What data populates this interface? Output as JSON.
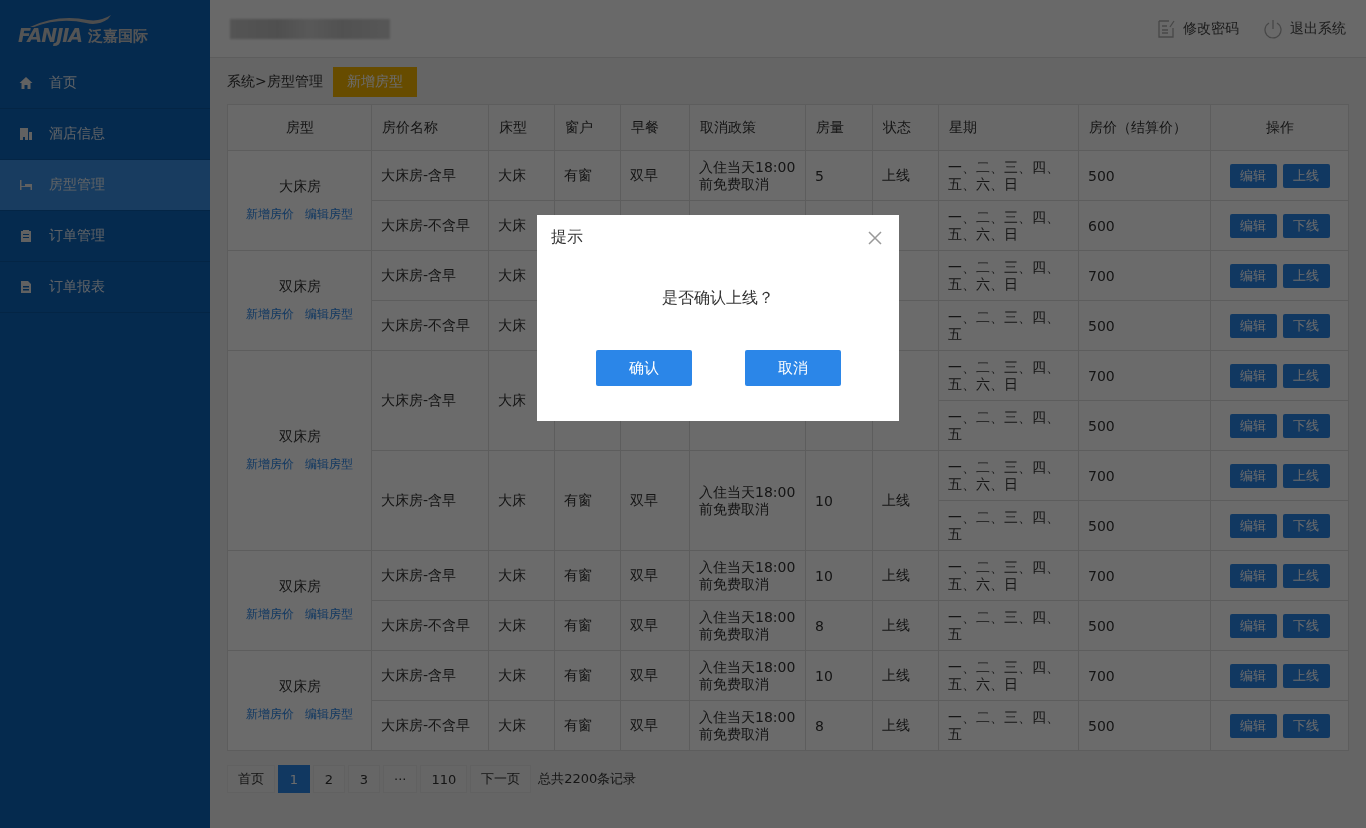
{
  "logo": {
    "latin": "FANJIA",
    "chinese": "泛嘉国际"
  },
  "sidebar": {
    "items": [
      {
        "label": "首页",
        "selected": false
      },
      {
        "label": "酒店信息",
        "selected": false
      },
      {
        "label": "房型管理",
        "selected": true
      },
      {
        "label": "订单管理",
        "selected": false
      },
      {
        "label": "订单报表",
        "selected": false
      }
    ]
  },
  "header": {
    "actions": [
      "修改密码",
      "退出系统"
    ]
  },
  "breadcrumb": "系统>房型管理",
  "add_button": "新增房型",
  "table": {
    "columns": [
      "房型",
      "房价名称",
      "床型",
      "窗户",
      "早餐",
      "取消政策",
      "房量",
      "状态",
      "星期",
      "房价（结算价）",
      "操作"
    ],
    "groups": [
      {
        "room_type": "大床房",
        "links": [
          "新增房价",
          "编辑房型"
        ],
        "rows": [
          {
            "name": "大床房-含早",
            "bed": "大床",
            "window": "有窗",
            "breakfast": "双早",
            "policy": "入住当天18:00前免费取消",
            "qty": "5",
            "status": "上线",
            "prices": [
              {
                "days": "一、二、三、四、五、六、日",
                "price": "500",
                "actions": [
                  "编辑",
                  "上线"
                ]
              }
            ]
          },
          {
            "name": "大床房-不含早",
            "bed": "大床",
            "prices": [
              {
                "days": "一、二、三、四、五、六、日",
                "price": "600",
                "actions": [
                  "编辑",
                  "下线"
                ]
              }
            ]
          }
        ]
      },
      {
        "room_type": "双床房",
        "links": [
          "新增房价",
          "编辑房型"
        ],
        "rows": [
          {
            "name": "大床房-含早",
            "bed": "大床",
            "prices": [
              {
                "days": "一、二、三、四、五、六、日",
                "price": "700",
                "actions": [
                  "编辑",
                  "上线"
                ]
              }
            ]
          },
          {
            "name": "大床房-不含早",
            "bed": "大床",
            "prices": [
              {
                "days": "一、二、三、四、五",
                "price": "500",
                "actions": [
                  "编辑",
                  "下线"
                ]
              }
            ]
          }
        ]
      },
      {
        "room_type": "双床房",
        "links": [
          "新增房价",
          "编辑房型"
        ],
        "rows": [
          {
            "name": "大床房-含早",
            "bed": "大床",
            "prices": [
              {
                "days": "一、二、三、四、五、六、日",
                "price": "700",
                "actions": [
                  "编辑",
                  "上线"
                ]
              },
              {
                "days": "一、二、三、四、五",
                "price": "500",
                "actions": [
                  "编辑",
                  "下线"
                ]
              }
            ]
          },
          {
            "name": "大床房-含早",
            "bed": "大床",
            "window": "有窗",
            "breakfast": "双早",
            "policy": "入住当天18:00前免费取消",
            "qty": "10",
            "status": "上线",
            "prices": [
              {
                "days": "一、二、三、四、五、六、日",
                "price": "700",
                "actions": [
                  "编辑",
                  "上线"
                ]
              },
              {
                "days": "一、二、三、四、五",
                "price": "500",
                "actions": [
                  "编辑",
                  "下线"
                ]
              }
            ]
          }
        ]
      },
      {
        "room_type": "双床房",
        "links": [
          "新增房价",
          "编辑房型"
        ],
        "rows": [
          {
            "name": "大床房-含早",
            "bed": "大床",
            "window": "有窗",
            "breakfast": "双早",
            "policy": "入住当天18:00前免费取消",
            "qty": "10",
            "status": "上线",
            "prices": [
              {
                "days": "一、二、三、四、五、六、日",
                "price": "700",
                "actions": [
                  "编辑",
                  "上线"
                ]
              }
            ]
          },
          {
            "name": "大床房-不含早",
            "bed": "大床",
            "window": "有窗",
            "breakfast": "双早",
            "policy": "入住当天18:00前免费取消",
            "qty": "8",
            "status": "上线",
            "prices": [
              {
                "days": "一、二、三、四、五",
                "price": "500",
                "actions": [
                  "编辑",
                  "下线"
                ]
              }
            ]
          }
        ]
      },
      {
        "room_type": "双床房",
        "links": [
          "新增房价",
          "编辑房型"
        ],
        "rows": [
          {
            "name": "大床房-含早",
            "bed": "大床",
            "window": "有窗",
            "breakfast": "双早",
            "policy": "入住当天18:00前免费取消",
            "qty": "10",
            "status": "上线",
            "prices": [
              {
                "days": "一、二、三、四、五、六、日",
                "price": "700",
                "actions": [
                  "编辑",
                  "上线"
                ]
              }
            ]
          },
          {
            "name": "大床房-不含早",
            "bed": "大床",
            "window": "有窗",
            "breakfast": "双早",
            "policy": "入住当天18:00前免费取消",
            "qty": "8",
            "status": "上线",
            "prices": [
              {
                "days": "一、二、三、四、五",
                "price": "500",
                "actions": [
                  "编辑",
                  "下线"
                ]
              }
            ]
          }
        ]
      }
    ]
  },
  "pagination": {
    "pages": [
      {
        "label": "首页",
        "selected": false
      },
      {
        "label": "1",
        "selected": true
      },
      {
        "label": "2",
        "selected": false
      },
      {
        "label": "3",
        "selected": false
      },
      {
        "label": "···",
        "selected": false
      },
      {
        "label": "110",
        "selected": false
      },
      {
        "label": "下一页",
        "selected": false
      }
    ],
    "total": "总共2200条记录"
  },
  "dialog": {
    "title": "提示",
    "message": "是否确认上线？",
    "buttons": [
      "确认",
      "取消"
    ]
  }
}
